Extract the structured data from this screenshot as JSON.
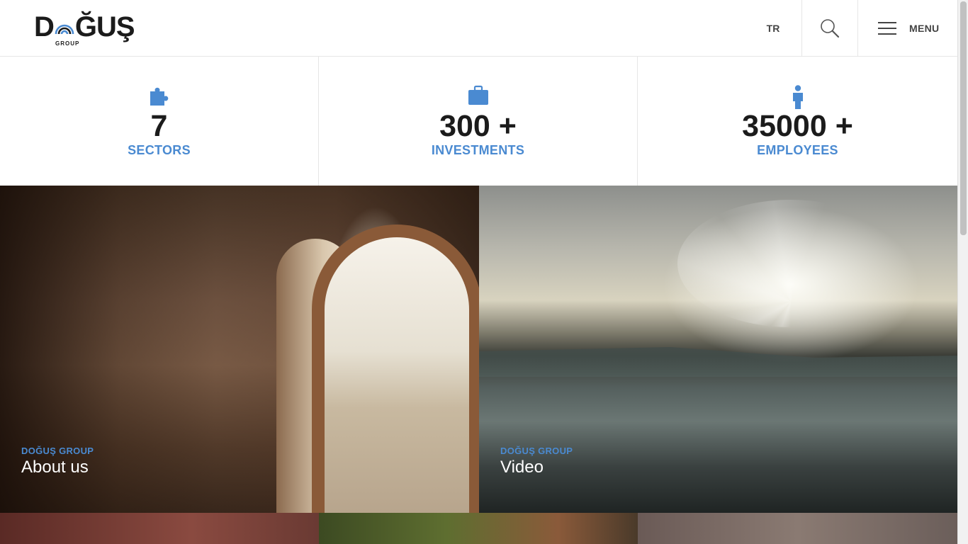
{
  "header": {
    "logo_text_left": "D",
    "logo_text_right": "ĞUŞ",
    "logo_sub": "GROUP",
    "lang_label": "TR",
    "menu_label": "MENU"
  },
  "stats": [
    {
      "icon": "puzzle-icon",
      "value": "7",
      "label": "SECTORS"
    },
    {
      "icon": "briefcase-icon",
      "value": "300 +",
      "label": "INVESTMENTS"
    },
    {
      "icon": "person-icon",
      "value": "35000 +",
      "label": "EMPLOYEES"
    }
  ],
  "tiles": [
    {
      "kicker": "DOĞUŞ GROUP",
      "title": "About us"
    },
    {
      "kicker": "DOĞUŞ GROUP",
      "title": "Video"
    }
  ],
  "colors": {
    "accent": "#4a8ad1",
    "text_dark": "#1b1b1b",
    "border": "#e6e6e6"
  }
}
